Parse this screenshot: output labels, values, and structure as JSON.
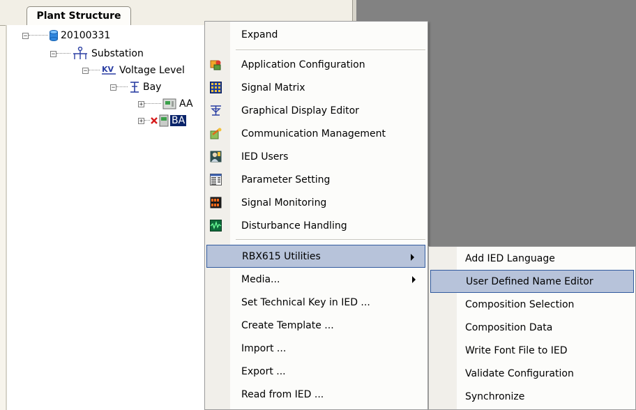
{
  "panel": {
    "tab_label": "Plant Structure"
  },
  "tree": {
    "root": "20100331",
    "substation": "Substation",
    "voltage_level": "Voltage Level",
    "bay": "Bay",
    "ied_aa": "AA",
    "ied_ba": "BA"
  },
  "context_menu": {
    "items": [
      {
        "label": "Expand",
        "icon": "none"
      },
      {
        "label": "Application Configuration",
        "icon": "app-config-icon"
      },
      {
        "label": "Signal Matrix",
        "icon": "signal-matrix-icon"
      },
      {
        "label": "Graphical Display Editor",
        "icon": "display-editor-icon"
      },
      {
        "label": "Communication Management",
        "icon": "communication-icon"
      },
      {
        "label": "IED Users",
        "icon": "users-icon"
      },
      {
        "label": "Parameter Setting",
        "icon": "parameter-icon"
      },
      {
        "label": "Signal Monitoring",
        "icon": "monitoring-icon"
      },
      {
        "label": "Disturbance Handling",
        "icon": "disturbance-icon"
      },
      {
        "label": "RBX615 Utilities",
        "icon": "none",
        "submenu": true,
        "highlighted": true
      },
      {
        "label": "Media...",
        "icon": "none",
        "submenu": true
      },
      {
        "label": "Set Technical Key in IED ...",
        "icon": "none"
      },
      {
        "label": "Create Template ...",
        "icon": "none"
      },
      {
        "label": "Import ...",
        "icon": "none"
      },
      {
        "label": "Export ...",
        "icon": "none"
      },
      {
        "label": "Read from IED ...",
        "icon": "none"
      }
    ]
  },
  "submenu": {
    "items": [
      {
        "label": "Add IED Language"
      },
      {
        "label": "User Defined Name Editor",
        "highlighted": true
      },
      {
        "label": "Composition Selection"
      },
      {
        "label": "Composition Data"
      },
      {
        "label": "Write Font File to IED"
      },
      {
        "label": "Validate Configuration"
      },
      {
        "label": "Synchronize"
      }
    ]
  },
  "colors": {
    "highlight_bg": "#b7c3da",
    "highlight_border": "#315a9e",
    "workspace_gray": "#828282"
  }
}
